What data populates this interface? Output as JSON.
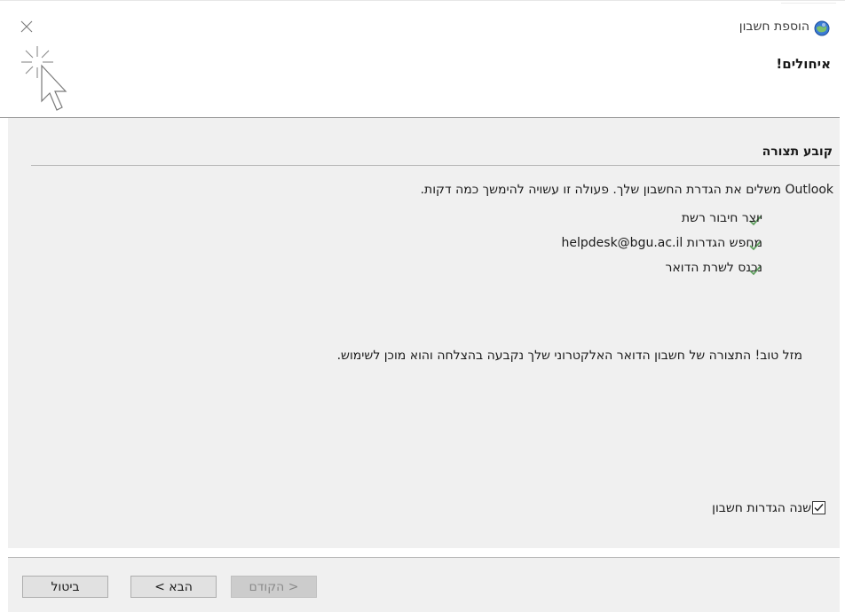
{
  "window": {
    "title": "הוספת חשבון",
    "close_icon": "close-icon",
    "app_icon": "outlook-account-icon"
  },
  "header": {
    "heading": "איחולים!",
    "illustration_icon": "sparkle-cursor-icon"
  },
  "section": {
    "title": "קובע תצורה",
    "intro": "Outlook משלים את הגדרת החשבון שלך. פעולה זו עשויה להימשך כמה דקות.",
    "steps": [
      {
        "label": "יוצר חיבור רשת",
        "status_icon": "checkmark-icon"
      },
      {
        "label": "מחפש הגדרות helpdesk@bgu.ac.il",
        "status_icon": "checkmark-icon"
      },
      {
        "label": "נכנס לשרת הדואר",
        "status_icon": "checkmark-icon"
      }
    ],
    "success_message": "מזל טוב! התצורה של חשבון הדואר האלקטרוני שלך נקבעה בהצלחה והוא מוכן לשימוש.",
    "change_settings_label": "שנה הגדרות חשבון",
    "change_settings_checked": true
  },
  "footer": {
    "back_label": "< הקודם",
    "next_label": "הבא >",
    "cancel_label": "ביטול"
  },
  "colors": {
    "check_green": "#5fa05f",
    "panel_bg": "#f0f0f0",
    "button_bg": "#e1e1e1",
    "button_disabled_bg": "#cccccc"
  }
}
